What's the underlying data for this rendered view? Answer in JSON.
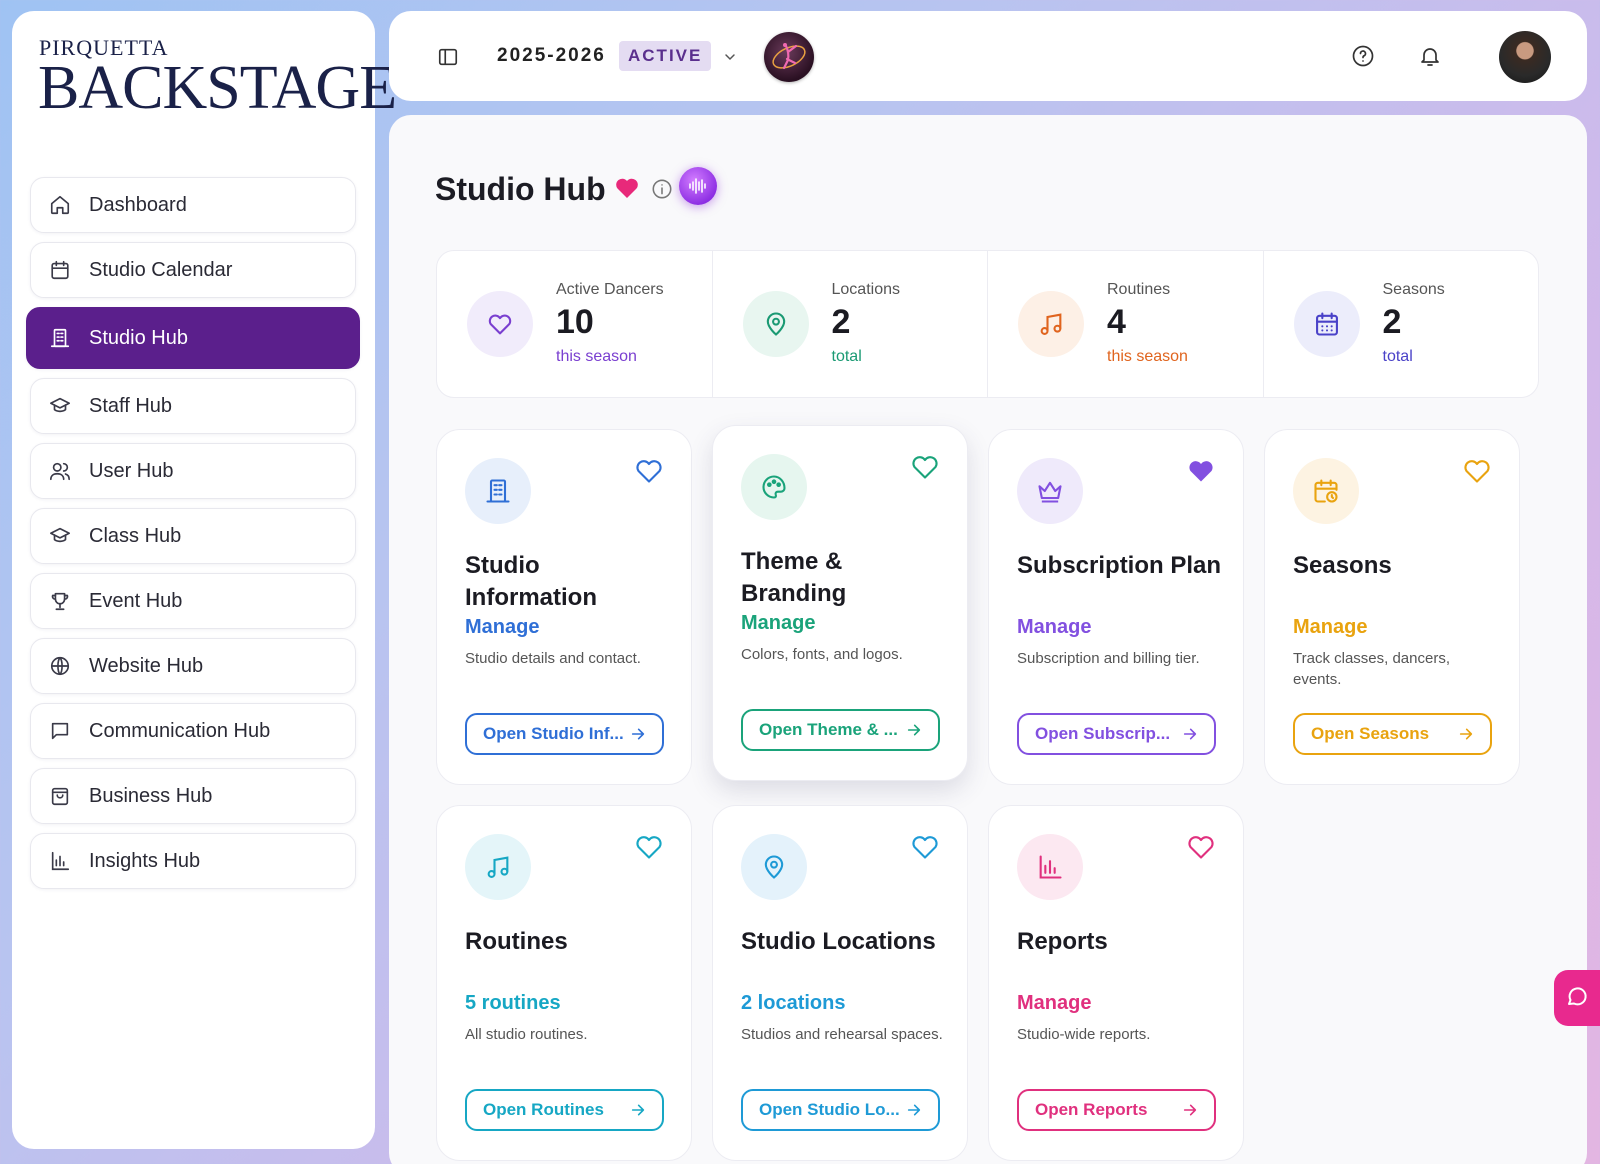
{
  "brand": {
    "line1": "PIRQUETTA",
    "line2": "BACKSTAGE"
  },
  "sidebar": {
    "items": [
      {
        "label": "Dashboard",
        "icon": "home-icon"
      },
      {
        "label": "Studio Calendar",
        "icon": "calendar-icon"
      },
      {
        "label": "Studio Hub",
        "icon": "building-icon",
        "active": true
      },
      {
        "label": "Staff Hub",
        "icon": "graduation-cap-icon"
      },
      {
        "label": "User Hub",
        "icon": "users-icon"
      },
      {
        "label": "Class Hub",
        "icon": "graduation-cap-icon"
      },
      {
        "label": "Event Hub",
        "icon": "trophy-icon"
      },
      {
        "label": "Website Hub",
        "icon": "globe-icon"
      },
      {
        "label": "Communication Hub",
        "icon": "message-square-icon"
      },
      {
        "label": "Business Hub",
        "icon": "shopping-bag-icon"
      },
      {
        "label": "Insights Hub",
        "icon": "bar-chart-icon"
      }
    ],
    "active_color": "#5b1f8c"
  },
  "topbar": {
    "season": "2025-2026",
    "status_badge": "ACTIVE"
  },
  "page": {
    "title": "Studio Hub"
  },
  "stats": [
    {
      "label": "Active Dancers",
      "value": "10",
      "sub": "this season",
      "color": "#7a3fd0"
    },
    {
      "label": "Locations",
      "value": "2",
      "sub": "total",
      "color": "#1a9a73"
    },
    {
      "label": "Routines",
      "value": "4",
      "sub": "this season",
      "color": "#e0641e"
    },
    {
      "label": "Seasons",
      "value": "2",
      "sub": "total",
      "color": "#4a42c8"
    }
  ],
  "cards": [
    {
      "title": "Studio Information",
      "link": "Manage",
      "desc": "Studio details and contact.",
      "button": "Open Studio Inf...",
      "color": "#2f6fd6",
      "favorited": false
    },
    {
      "title": "Theme & Branding",
      "link": "Manage",
      "desc": "Colors, fonts, and logos.",
      "button": "Open Theme & ...",
      "color": "#1aa37a",
      "favorited": false
    },
    {
      "title": "Subscription Plan",
      "link": "Manage",
      "desc": "Subscription and billing tier.",
      "button": "Open Subscrip...",
      "color": "#8250e0",
      "favorited": true
    },
    {
      "title": "Seasons",
      "link": "Manage",
      "desc": "Track classes, dancers, events.",
      "button": "Open Seasons",
      "color": "#e9a30f",
      "favorited": false
    },
    {
      "title": "Routines",
      "link": "5 routines",
      "desc": "All studio routines.",
      "button": "Open Routines",
      "color": "#16a7c4",
      "favorited": false
    },
    {
      "title": "Studio Locations",
      "link": "2 locations",
      "desc": "Studios and rehearsal spaces.",
      "button": "Open Studio Lo...",
      "color": "#1e9ad6",
      "favorited": false
    },
    {
      "title": "Reports",
      "link": "Manage",
      "desc": "Studio-wide reports.",
      "button": "Open Reports",
      "color": "#e0307e",
      "favorited": false
    }
  ]
}
